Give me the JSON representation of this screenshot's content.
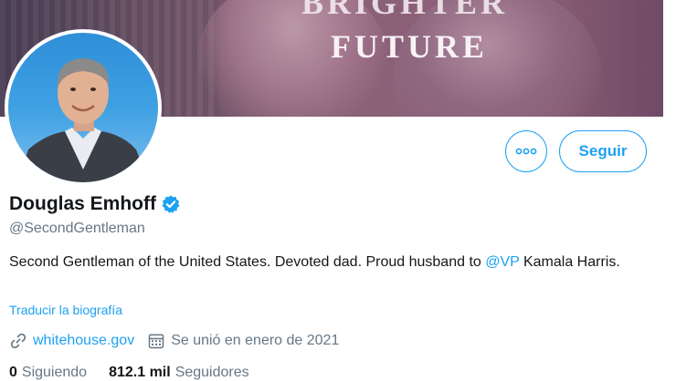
{
  "banner": {
    "tagline_top": "BRIGHTER",
    "tagline": "FUTURE"
  },
  "profile": {
    "name": "Douglas Emhoff",
    "handle": "@SecondGentleman",
    "bio_text": "Second Gentleman of the United States. Devoted dad. Proud husband to ",
    "bio_mention": "@VP",
    "bio_text_end": " Kamala Harris.",
    "translate_label": "Traducir la biografía",
    "website": "whitehouse.gov",
    "joined": "Se unió en enero de 2021"
  },
  "actions": {
    "follow_label": "Seguir"
  },
  "stats": {
    "following_count": "0",
    "following_label": "Siguiendo",
    "followers_count": "812.1 mil",
    "followers_label": "Seguidores"
  },
  "colors": {
    "accent": "#1da1f2",
    "secondary_text": "#657786",
    "primary_text": "#14171a"
  }
}
